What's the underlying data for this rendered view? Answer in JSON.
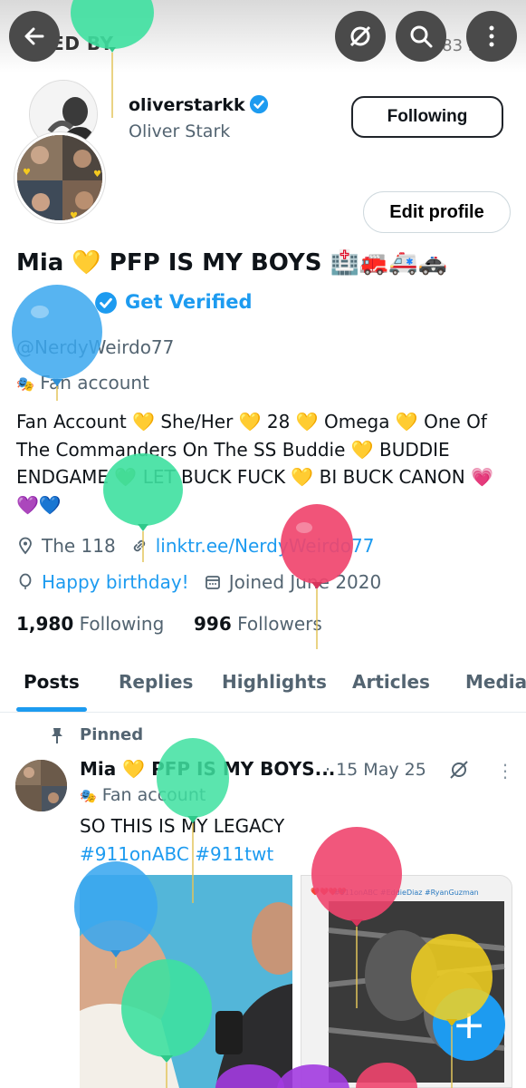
{
  "header": {
    "title": "LIKED BY",
    "likes_count": "583 likes",
    "back_icon": "arrow-left-icon",
    "icons": [
      "no-signal-icon",
      "search-icon",
      "more-vertical-icon"
    ]
  },
  "liker": {
    "username": "oliverstarkk",
    "display_name": "Oliver Stark",
    "follow_label": "Following"
  },
  "profile": {
    "edit_label": "Edit profile",
    "display_name": "Mia 💛 PFP IS MY BOYS 🏥🚒🚑🚓",
    "get_verified": "Get Verified",
    "handle": "@NerdyWeirdo77",
    "account_type": "Fan account",
    "bio": "Fan Account 💛 She/Her 💛 28 💛 Omega 💛 One Of The Commanders On The SS Buddie 💛 BUDDIE ENDGAME 💚 LET BUCK FUCK 💛 BI BUCK CANON 💗💜💙",
    "location": "The 118",
    "link": "linktr.ee/NerdyWeirdo77",
    "birthday": "Happy birthday!",
    "joined": "Joined June 2020",
    "following_count": "1,980",
    "following_label": "Following",
    "followers_count": "996",
    "followers_label": "Followers"
  },
  "tabs": [
    "Posts",
    "Replies",
    "Highlights",
    "Articles",
    "Media"
  ],
  "post": {
    "pinned_label": "Pinned",
    "author": "Mia 💛 PFP IS MY BOYS...",
    "date": "· 15 May 25",
    "account_type": "Fan account",
    "text": "SO THIS IS MY LEGACY",
    "tags": "#911onABC #911twt",
    "media2_caption": "#911onABC #EddieDiaz #RyanGuzman"
  },
  "fab_label": "+",
  "colors": {
    "accent": "#1d9bf0",
    "text": "#0f1419",
    "muted": "#536471",
    "balloon_green": "#3ee0a0",
    "balloon_blue": "#3aa7ef",
    "balloon_pink": "#f0456e",
    "balloon_yellow": "#f4d21f"
  }
}
